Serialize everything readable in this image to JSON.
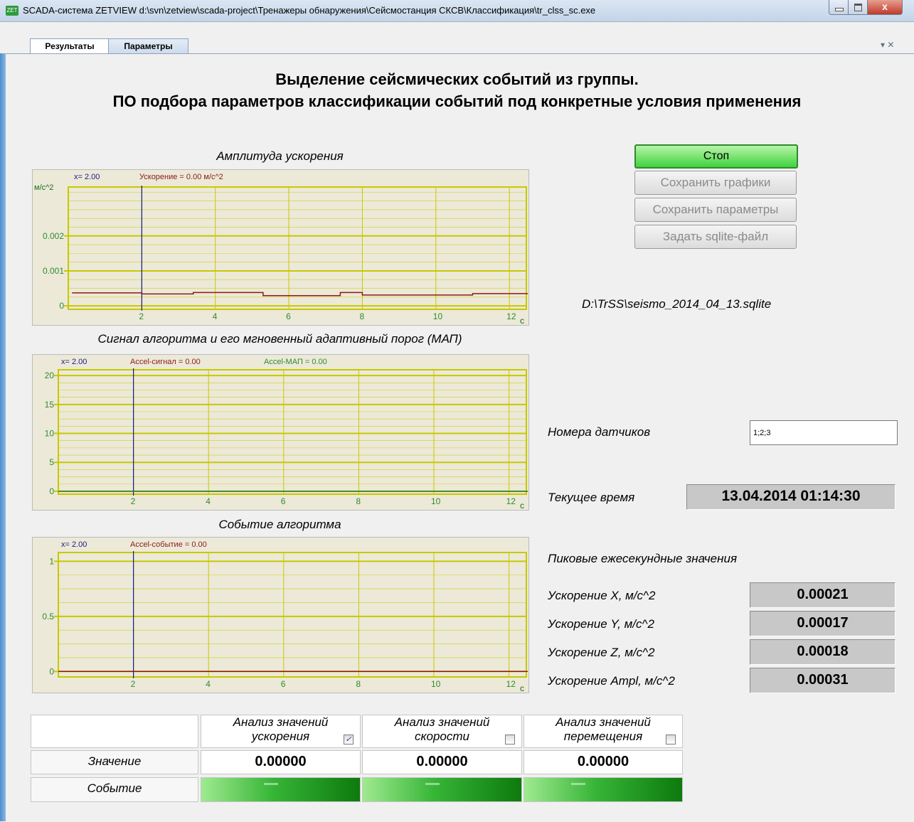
{
  "window": {
    "title": "SCADA-система ZETVIEW d:\\svn\\zetview\\scada-project\\Тренажеры обнаружения\\Сейсмостанция СКСВ\\Классификация\\tr_clss_sc.exe",
    "close_glyph": "x"
  },
  "tabs": [
    {
      "label": "Результаты",
      "active": true
    },
    {
      "label": "Параметры",
      "active": false
    }
  ],
  "tabs_controls": "▾ ✕",
  "header": {
    "line1": "Выделение сейсмических событий из группы.",
    "line2": "ПО подбора параметров классификации событий под конкретные условия применения"
  },
  "charts": {
    "accel": {
      "title": "Амплитуда ускорения",
      "readout_x": "x=  2.00",
      "readout_series": "Ускорение = 0.00 м/с^2",
      "yunit": "м/с^2",
      "xunit": "с"
    },
    "signal": {
      "title": "Сигнал алгоритма и его мгновенный адаптивный порог (МАП)",
      "readout_x": "x=  2.00",
      "readout_series": "Accel-сигнал = 0.00",
      "readout_series2": "Accel-МАП = 0.00",
      "xunit": "с"
    },
    "event": {
      "title": "Событие алгоритма",
      "readout_x": "x=  2.00",
      "readout_series": "Accel-событие = 0.00",
      "xunit": "с"
    }
  },
  "chart_data": [
    {
      "type": "line",
      "title": "Амплитуда ускорения",
      "ylabel": "м/с^2",
      "xlabel": "с",
      "xlim": [
        0,
        12.5
      ],
      "ylim": [
        -0.0001,
        0.0034
      ],
      "x_ticks": [
        2,
        4,
        6,
        8,
        10,
        12
      ],
      "y_ticks": [
        0,
        0.001,
        0.002
      ],
      "y_tick_labels": [
        "0",
        "0.001",
        "0.002"
      ],
      "series": [
        {
          "name": "Ускорение",
          "color": "#8b1a1a",
          "x": [
            0.1,
            2.0,
            2.0,
            3.4,
            3.4,
            5.3,
            5.3,
            7.4,
            7.4,
            8.0,
            8.0,
            11.0,
            11.0,
            12.5
          ],
          "y": [
            0.00037,
            0.00037,
            0.00034,
            0.00034,
            0.00038,
            0.00038,
            0.00029,
            0.00029,
            0.00038,
            0.00038,
            0.00031,
            0.00031,
            0.00035,
            0.00035
          ]
        }
      ],
      "cursor_x": 2.0,
      "grid": true
    },
    {
      "type": "line",
      "title": "Сигнал алгоритма и его мгновенный адаптивный порог (МАП)",
      "xlabel": "с",
      "xlim": [
        0,
        12.5
      ],
      "ylim": [
        -0.5,
        21
      ],
      "x_ticks": [
        2,
        4,
        6,
        8,
        10,
        12
      ],
      "y_ticks": [
        0,
        5,
        10,
        15,
        20
      ],
      "series": [
        {
          "name": "Accel-сигнал",
          "color": "#8b1a1a",
          "x": [
            0.0,
            12.5
          ],
          "y": [
            0,
            0
          ]
        },
        {
          "name": "Accel-МАП",
          "color": "#2e8b2e",
          "x": [
            0.0,
            12.5
          ],
          "y": [
            0,
            0
          ]
        }
      ],
      "cursor_x": 2.0,
      "grid": true
    },
    {
      "type": "line",
      "title": "Событие алгоритма",
      "xlabel": "с",
      "xlim": [
        0,
        12.5
      ],
      "ylim": [
        -0.05,
        1.08
      ],
      "x_ticks": [
        2,
        4,
        6,
        8,
        10,
        12
      ],
      "y_ticks": [
        0,
        0.5,
        1
      ],
      "series": [
        {
          "name": "Accel-событие",
          "color": "#8b1a1a",
          "x": [
            0.0,
            12.5
          ],
          "y": [
            0,
            0
          ]
        }
      ],
      "cursor_x": 2.0,
      "grid": true
    }
  ],
  "controls": {
    "stop": "Стоп",
    "save_charts": "Сохранить графики",
    "save_params": "Сохранить параметры",
    "set_sqlite": "Задать sqlite-файл",
    "file_path": "D:\\TrSS\\seismo_2014_04_13.sqlite"
  },
  "sensors": {
    "label": "Номера датчиков",
    "value": "1;2;3"
  },
  "current_time": {
    "label": "Текущее время",
    "value": "13.04.2014 01:14:30"
  },
  "peaks": {
    "title": "Пиковые ежесекундные значения",
    "items": [
      {
        "label": "Ускорение  X, м/с^2",
        "value": "0.00021"
      },
      {
        "label": "Ускорение Y, м/с^2",
        "value": "0.00017"
      },
      {
        "label": "Ускорение  Z, м/с^2",
        "value": "0.00018"
      },
      {
        "label": "Ускорение Ampl, м/с^2",
        "value": "0.00031"
      }
    ]
  },
  "analysis": {
    "columns": [
      {
        "line1": "Анализ значений",
        "line2": "ускорения",
        "checked": true,
        "value": "0.00000"
      },
      {
        "line1": "Анализ значений",
        "line2": "скорости",
        "checked": false,
        "value": "0.00000"
      },
      {
        "line1": "Анализ значений",
        "line2": "перемещения",
        "checked": false,
        "value": "0.00000"
      }
    ],
    "row_value": "Значение",
    "row_event": "Событие"
  },
  "colors": {
    "plot_grid": "#c8c800",
    "cursor": "#1a1a8c",
    "tick_green": "#2e8b2e",
    "button_green": "#3fd23f"
  }
}
